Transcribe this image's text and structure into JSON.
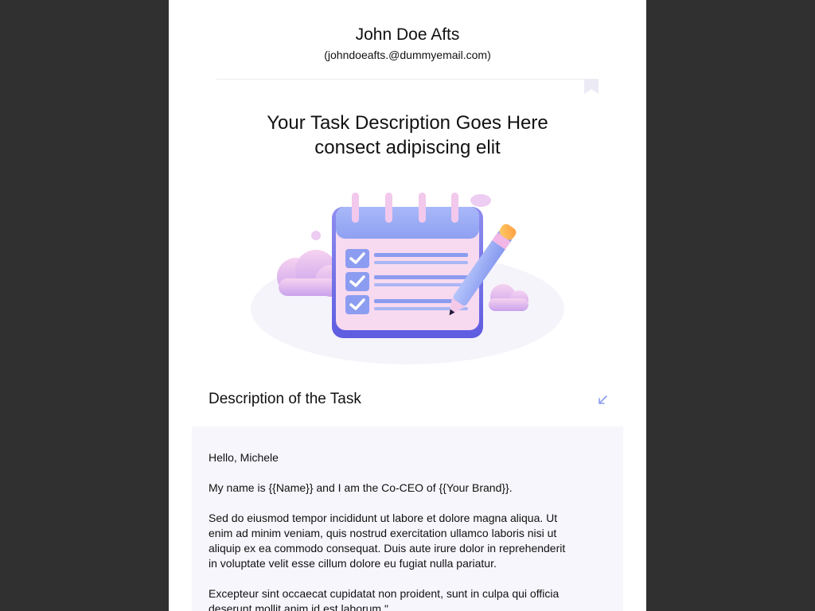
{
  "sender": {
    "name": "John Doe Afts",
    "email": "(johndoeafts.@dummyemail.com)"
  },
  "headline": {
    "line1": "Your Task Description Goes Here",
    "line2": "consect adipiscing elit"
  },
  "hero": {
    "icon": "calendar-checklist-pencil-illustration"
  },
  "section": {
    "title": "Description of the Task",
    "toggle_icon": "collapse-arrow-icon"
  },
  "message": {
    "greeting": "Hello, Michele",
    "intro": "My name is {{Name}} and I am the Co-CEO of {{Your Brand}}.",
    "paragraph1": "Sed do eiusmod tempor incididunt ut labore et dolore magna aliqua. Ut enim ad minim veniam, quis nostrud exercitation ullamco laboris nisi ut aliquip ex ea commodo consequat. Duis aute irure dolor in reprehenderit in voluptate velit esse cillum dolore eu fugiat nulla pariatur.",
    "paragraph2": "Excepteur sint occaecat cupidatat non proident, sunt in culpa qui officia deserunt mollit anim id est laborum.\""
  },
  "colors": {
    "background": "#303030",
    "card": "#ffffff",
    "body_box": "#f7f6fc",
    "accent": "#8c9cf0"
  }
}
